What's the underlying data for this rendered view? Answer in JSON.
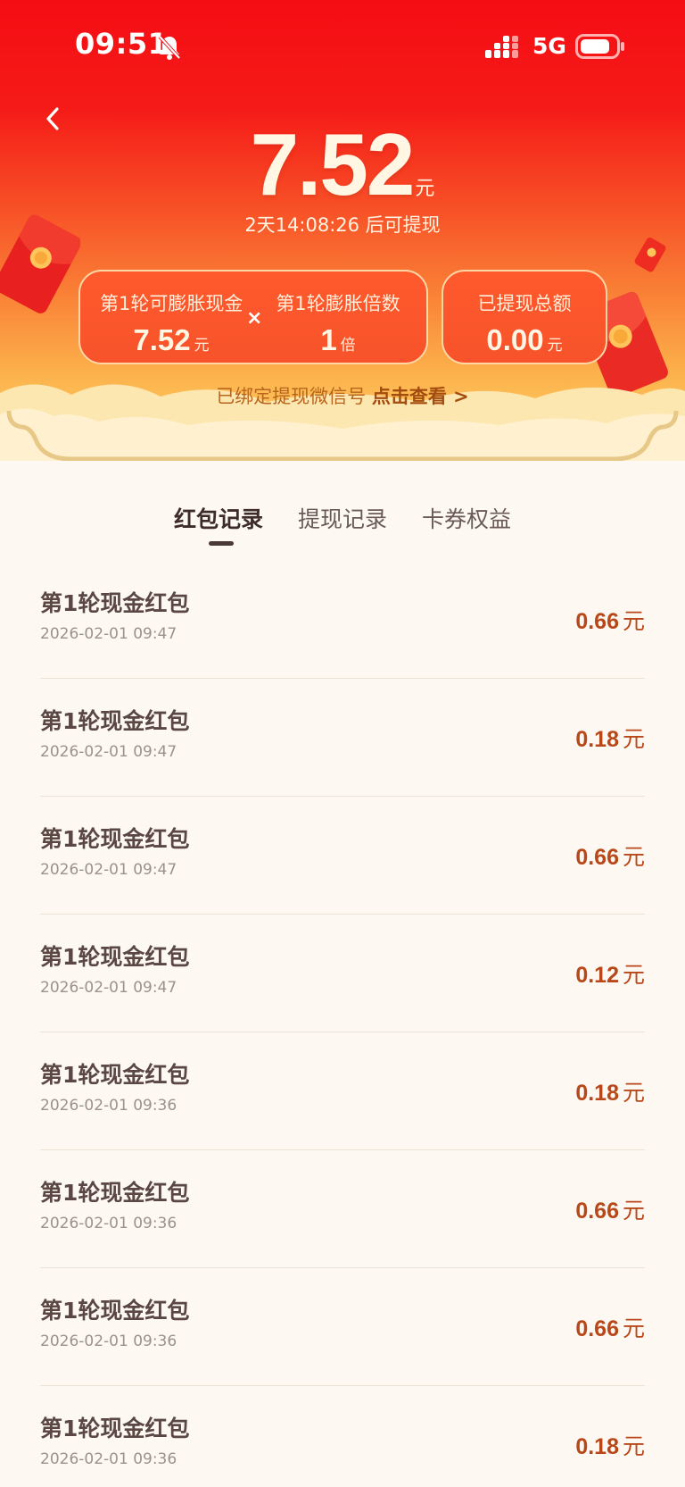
{
  "status_bar": {
    "time": "09:51",
    "network": "5G"
  },
  "balance": {
    "amount": "7.52",
    "unit": "元",
    "countdown": "2天14:08:26 后可提现"
  },
  "cards": {
    "round_cash_label": "第1轮可膨胀现金",
    "round_cash_value": "7.52",
    "round_cash_unit": "元",
    "times_sign": "×",
    "multiplier_label": "第1轮膨胀倍数",
    "multiplier_value": "1",
    "multiplier_unit": "倍",
    "withdrawn_label": "已提现总额",
    "withdrawn_value": "0.00",
    "withdrawn_unit": "元"
  },
  "wechat": {
    "text": "已绑定提现微信号",
    "link": "点击查看 >"
  },
  "tabs": [
    {
      "label": "红包记录",
      "active": true
    },
    {
      "label": "提现记录",
      "active": false
    },
    {
      "label": "卡券权益",
      "active": false
    }
  ],
  "records": [
    {
      "title": "第1轮现金红包",
      "time": "2026-02-01 09:47",
      "amount": "0.66",
      "unit": "元"
    },
    {
      "title": "第1轮现金红包",
      "time": "2026-02-01 09:47",
      "amount": "0.18",
      "unit": "元"
    },
    {
      "title": "第1轮现金红包",
      "time": "2026-02-01 09:47",
      "amount": "0.66",
      "unit": "元"
    },
    {
      "title": "第1轮现金红包",
      "time": "2026-02-01 09:47",
      "amount": "0.12",
      "unit": "元"
    },
    {
      "title": "第1轮现金红包",
      "time": "2026-02-01 09:36",
      "amount": "0.18",
      "unit": "元"
    },
    {
      "title": "第1轮现金红包",
      "time": "2026-02-01 09:36",
      "amount": "0.66",
      "unit": "元"
    },
    {
      "title": "第1轮现金红包",
      "time": "2026-02-01 09:36",
      "amount": "0.66",
      "unit": "元"
    },
    {
      "title": "第1轮现金红包",
      "time": "2026-02-01 09:36",
      "amount": "0.18",
      "unit": "元"
    }
  ],
  "icons": {
    "back": "chevron-left-icon",
    "mute": "bell-off-icon",
    "signal": "signal-icon",
    "battery": "battery-icon"
  },
  "colors": {
    "header_red": "#f50d14",
    "header_gold": "#ffd266",
    "amount_brown": "#b8481a",
    "background": "#fdf8f1"
  }
}
